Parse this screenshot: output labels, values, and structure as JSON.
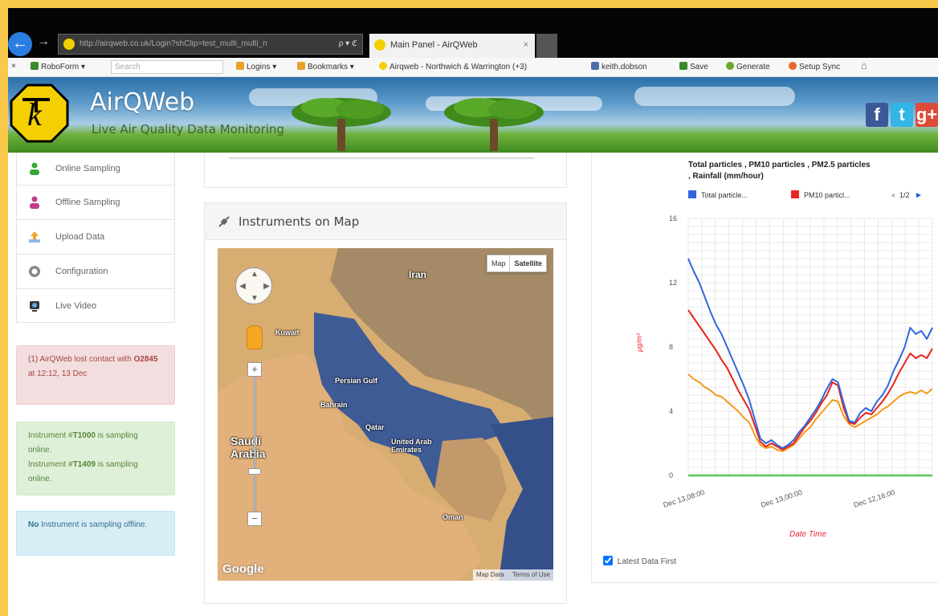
{
  "browser": {
    "address": "http://airqweb.co.uk/Login?shClip=test_multi_multi_n",
    "address_search": "ρ ▾ ℭ",
    "tab_title": "Main Panel - AirQWeb",
    "tab_close": "×",
    "favorites_bar": {
      "close": "×",
      "roboform": "RoboForm ▾",
      "search_placeholder": "Search",
      "logins": "Logins ▾",
      "bookmarks": "Bookmarks ▾",
      "airqweb_link": "Airqweb - Northwich & Warrington (+3)",
      "user": "keith.dobson",
      "save": "Save",
      "generate": "Generate",
      "setup_sync": "Setup Sync"
    }
  },
  "header": {
    "site_name": "AirQWeb",
    "tagline": "Live Air Quality Data Monitoring",
    "social": [
      "f",
      "t",
      "g+"
    ],
    "colors": {
      "facebook": "#3b5998",
      "twitter": "#33b5e5",
      "google": "#dd4b39"
    }
  },
  "sidenav": {
    "items": [
      {
        "label": "Online Sampling",
        "icon": "person-green-icon",
        "color": "#3aa63a"
      },
      {
        "label": "Offline Sampling",
        "icon": "person-pink-icon",
        "color": "#c23b8c"
      },
      {
        "label": "Upload Data",
        "icon": "upload-icon",
        "color": "#4a90d9"
      },
      {
        "label": "Configuration",
        "icon": "gear-icon",
        "color": "#888888"
      },
      {
        "label": "Live Video",
        "icon": "webcam-icon",
        "color": "#333333"
      }
    ]
  },
  "alerts": {
    "danger": {
      "prefix": "(1) AirQWeb lost contact with",
      "instrument": "O2845",
      "suffix": "at 12:12, 13 Dec"
    },
    "success": [
      {
        "prefix": "Instrument #",
        "id": "T1000",
        "suffix": "is sampling online."
      },
      {
        "prefix": "Instrument #",
        "id": "T1409",
        "suffix": "is sampling online."
      }
    ],
    "info": {
      "bold": "No",
      "rest": "Instrument is sampling offline."
    }
  },
  "map_panel": {
    "title": "Instruments on Map",
    "map_type": {
      "map": "Map",
      "satellite": "Satellite",
      "selected": "satellite"
    },
    "zoom_in": "+",
    "zoom_out": "−",
    "labels": {
      "iran": "Iran",
      "kuwait": "Kuwait",
      "persian_gulf": "Persian Gulf",
      "bahrain": "Bahrain",
      "qatar": "Qatar",
      "uae": "United Arab Emirates",
      "saudi": "Saudi Arabia",
      "oman": "Oman"
    },
    "google": "Google",
    "attribution": [
      "Map Data",
      "Terms of Use"
    ]
  },
  "chart_panel": {
    "latest_first_label": "Latest Data First",
    "latest_first_checked": true
  },
  "chart_data": {
    "type": "line",
    "title": "Total particles , PM10 particles , PM2.5 particles , Rainfall (mm/hour)",
    "legend": {
      "entries": [
        "Total particle...",
        "PM10 particl..."
      ],
      "page": "1/2",
      "prev": "◄",
      "next": "►",
      "position": "top"
    },
    "ylabel": "μg/m³",
    "xlabel": "Date Time",
    "ylim": [
      0,
      16
    ],
    "yticks": [
      "0",
      "4",
      "8",
      "12",
      "16"
    ],
    "xticks": [
      "Dec 13,08:00",
      "Dec 13,00:00",
      "Dec 12,16:00"
    ],
    "grid": true,
    "series": [
      {
        "name": "Total particles",
        "color": "#3366dd",
        "values": [
          13.5,
          12.7,
          12.0,
          11.1,
          10.2,
          9.4,
          8.8,
          8.0,
          7.2,
          6.4,
          5.6,
          4.7,
          3.5,
          2.3,
          2.0,
          2.2,
          1.9,
          1.7,
          1.9,
          2.2,
          2.7,
          3.1,
          3.6,
          4.1,
          4.7,
          5.4,
          6.0,
          5.8,
          4.5,
          3.4,
          3.3,
          3.9,
          4.2,
          4.0,
          4.6,
          5.0,
          5.6,
          6.5,
          7.2,
          8.0,
          9.2,
          8.8,
          9.0,
          8.5,
          9.2
        ]
      },
      {
        "name": "PM10 particles",
        "color": "#e8251c",
        "values": [
          10.3,
          9.8,
          9.3,
          8.8,
          8.3,
          7.8,
          7.2,
          6.7,
          6.0,
          5.3,
          4.7,
          4.1,
          3.1,
          2.1,
          1.8,
          2.0,
          1.8,
          1.6,
          1.8,
          2.0,
          2.5,
          3.0,
          3.4,
          3.9,
          4.5,
          5.0,
          5.8,
          5.6,
          4.2,
          3.3,
          3.2,
          3.6,
          3.9,
          3.8,
          4.2,
          4.6,
          5.1,
          5.7,
          6.4,
          7.0,
          7.6,
          7.3,
          7.5,
          7.3,
          7.9
        ]
      },
      {
        "name": "PM2.5 particles",
        "color": "#f59a1b",
        "values": [
          6.3,
          6.0,
          5.8,
          5.5,
          5.3,
          5.0,
          4.9,
          4.6,
          4.3,
          4.0,
          3.6,
          3.3,
          2.5,
          1.9,
          1.7,
          1.8,
          1.6,
          1.5,
          1.7,
          1.9,
          2.3,
          2.7,
          3.0,
          3.5,
          3.9,
          4.3,
          4.7,
          4.6,
          3.7,
          3.2,
          3.0,
          3.2,
          3.4,
          3.6,
          3.8,
          4.1,
          4.3,
          4.6,
          4.9,
          5.1,
          5.2,
          5.1,
          5.3,
          5.1,
          5.4
        ]
      },
      {
        "name": "Rainfall (mm/hour)",
        "color": "#5cc75c",
        "values": [
          0,
          0,
          0,
          0,
          0,
          0,
          0,
          0,
          0,
          0,
          0,
          0,
          0,
          0,
          0,
          0,
          0,
          0,
          0,
          0,
          0,
          0,
          0,
          0,
          0,
          0,
          0,
          0,
          0,
          0,
          0,
          0,
          0,
          0,
          0,
          0,
          0,
          0,
          0,
          0,
          0,
          0,
          0,
          0,
          0
        ]
      }
    ]
  }
}
